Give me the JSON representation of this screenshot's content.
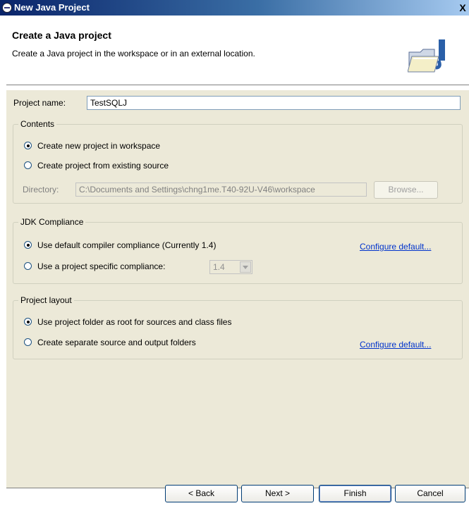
{
  "window": {
    "title": "New Java Project",
    "close_label": "X"
  },
  "header": {
    "title": "Create a Java project",
    "description": "Create a Java project in the workspace or in an external location."
  },
  "project_name": {
    "label": "Project name:",
    "value": "TestSQLJ"
  },
  "contents": {
    "title": "Contents",
    "option_new": "Create new project in workspace",
    "option_existing": "Create project from existing source",
    "directory_label": "Directory:",
    "directory_value": "C:\\Documents and Settings\\chng1me.T40-92U-V46\\workspace",
    "browse_label": "Browse..."
  },
  "jdk": {
    "title": "JDK Compliance",
    "option_default": "Use default compiler compliance (Currently 1.4)",
    "option_specific": "Use a project specific compliance:",
    "compliance_value": "1.4",
    "configure_link": "Configure default..."
  },
  "layout": {
    "title": "Project layout",
    "option_root": "Use project folder as root for sources and class files",
    "option_separate": "Create separate source and output folders",
    "configure_link": "Configure default..."
  },
  "buttons": {
    "back": "< Back",
    "next": "Next >",
    "finish": "Finish",
    "cancel": "Cancel"
  }
}
